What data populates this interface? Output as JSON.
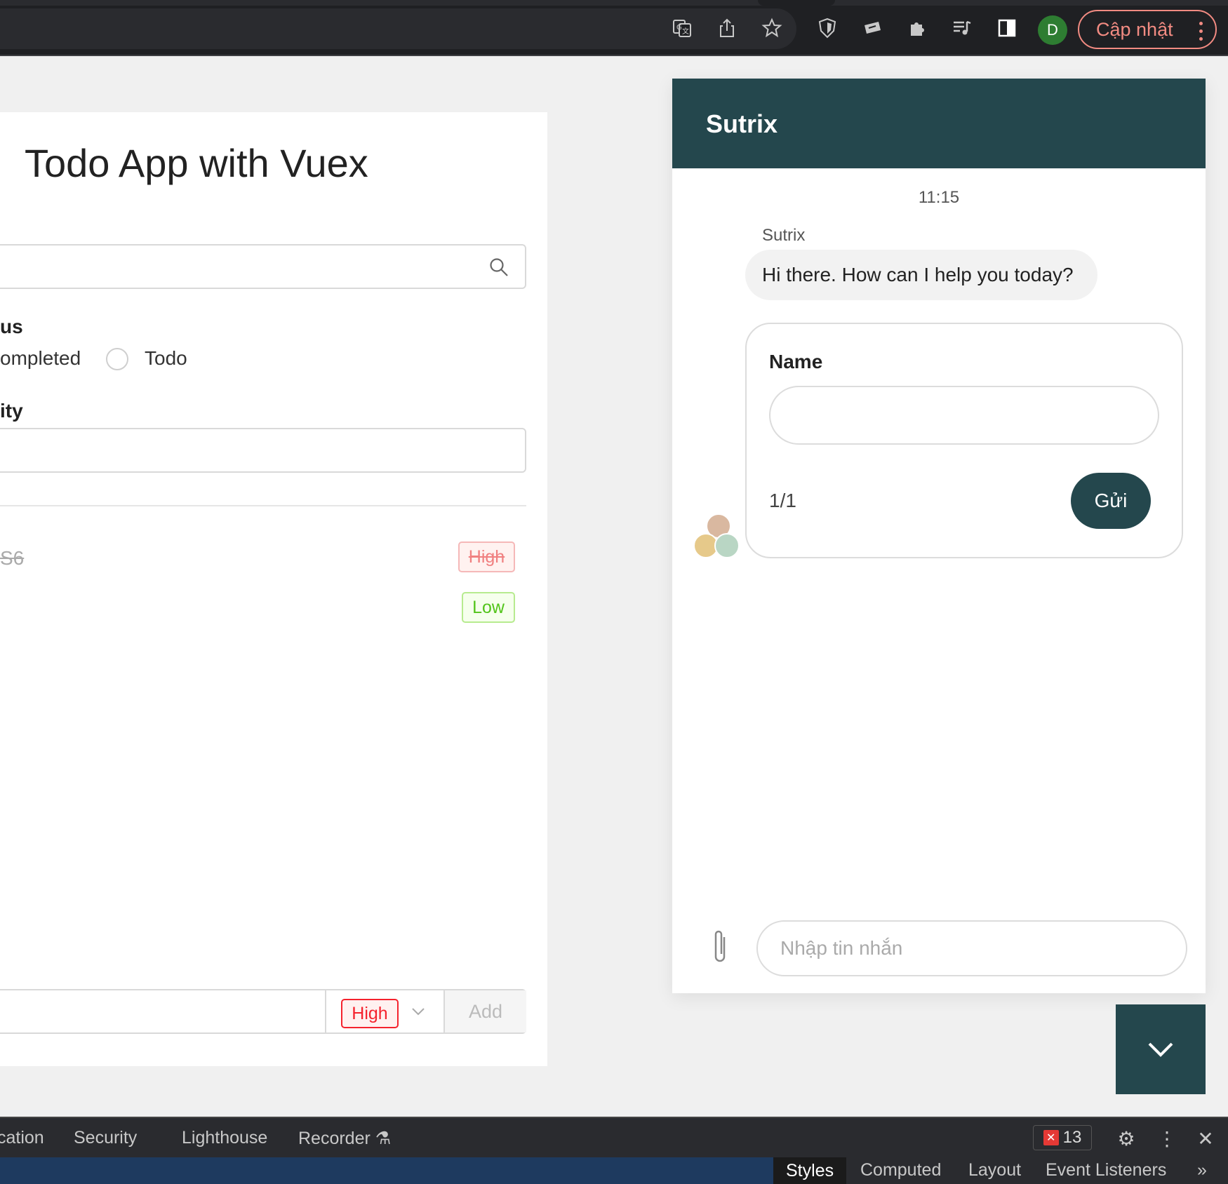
{
  "browser": {
    "avatar_letter": "D",
    "update_label": "Cập nhật",
    "update_color": "#f28b82",
    "avatar_color": "#2e7d32",
    "toolbar_icons": [
      "translate-icon",
      "share-icon",
      "star-icon",
      "shield-icon",
      "extension-card-icon",
      "puzzle-icon",
      "media-queue-icon",
      "side-panel-icon"
    ]
  },
  "todo": {
    "title": "Todo App with Vuex",
    "status_label": "us",
    "radio_completed_label": "ompleted",
    "radio_todo_label": "Todo",
    "priority_label": "ity",
    "items": [
      {
        "text": "S6",
        "tag": "High",
        "done": true
      },
      {
        "text": "",
        "tag": "Low",
        "done": false
      }
    ],
    "new_priority_tag": "High",
    "add_label": "Add"
  },
  "chat": {
    "title": "Sutrix",
    "time": "11:15",
    "sender": "Sutrix",
    "message": "Hi there. How can I help you today?",
    "form_label": "Name",
    "page_count": "1/1",
    "send_label": "Gửi",
    "input_placeholder": "Nhập tin nhắn",
    "brand_color": "#24474d"
  },
  "devtools": {
    "tabs": [
      "cation",
      "Security",
      "Lighthouse",
      "Recorder"
    ],
    "error_count": "13",
    "sub_tabs": [
      "Styles",
      "Computed",
      "Layout",
      "Event Listeners"
    ]
  }
}
